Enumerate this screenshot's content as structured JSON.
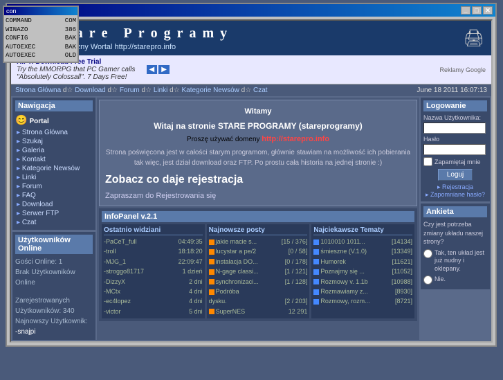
{
  "window": {
    "title": "Stare Programy",
    "controls": [
      "_",
      "□",
      "X"
    ]
  },
  "old_window": {
    "title": "con",
    "rows": [
      {
        "label": "COMMAND",
        "value": "COM"
      },
      {
        "label": "WINAZO",
        "value": "386"
      },
      {
        "label": "CONFIG",
        "value": "BAK"
      },
      {
        "label": "AUTOEXEC",
        "value": "BAK"
      },
      {
        "label": "AUTOEXEC",
        "value": "OLD"
      }
    ]
  },
  "site": {
    "logo_text": "Stare Programy",
    "subtitle": "Niezależny Wortal  http://starepro.info",
    "icon": "🖨️"
  },
  "ad": {
    "title": "RIFT: Download Free Trial",
    "line1": "Try the MMORPG that PC Gamer calls",
    "line2": "\"Absolutely Colossall\". 7 Days Free!",
    "google_label": "Reklamy Google"
  },
  "breadcrumb": {
    "items": [
      "Strona Główna",
      "Download",
      "Forum",
      "Linki",
      "Kategorie Newsów",
      "Czat"
    ],
    "separator": "d☆"
  },
  "datetime": "June 18 2011  16:07:13",
  "sidebar": {
    "title": "Nawigacja",
    "emoji": "😊",
    "portal_label": "Portal",
    "items": [
      "Strona Główna",
      "Szukaj",
      "Galeria",
      "Kontakt",
      "Kategorie Newsów",
      "Linki",
      "Forum",
      "FAQ",
      "Download",
      "Serwer FTP",
      "Czat"
    ]
  },
  "online": {
    "title": "Użytkowników Online",
    "guests": "Gości Online: 1",
    "no_users": "Brak Użytkowników Online",
    "registered_label": "Zarejestrowanych Użytkowników: 340",
    "newest_label": "Najnowszy Użytkownik:",
    "newest": "-snajpi"
  },
  "welcome": {
    "section": "Witamy",
    "title": "Witaj na stronie STARE PROGRAMY (stareprogramy)",
    "domain_prompt": "Proszę używać domeny",
    "domain": "http://starepro.info",
    "text": "Strona poświęcona jest w całości starym programom, głównie stawiam na możliwość ich pobierania tak więc, jest dział download oraz FTP. Po prostu cała historia na jednej stronie :)",
    "big_text": "Zobacz co daje rejestracja",
    "register_text": "Zapraszam do Rejestrowania się"
  },
  "infopanel": {
    "title": "InfoPanel v.2.1",
    "cols": [
      {
        "title": "Ostatnio widziani",
        "rows": [
          {
            "name": "-PaCeT_full",
            "time": "04:49:35"
          },
          {
            "name": "-troll",
            "time": "18:18:20"
          },
          {
            "name": "-MJG_1",
            "time": "22:09:47"
          },
          {
            "name": "-stroggo81717",
            "time": "1 dzień"
          },
          {
            "name": "-DizzyX",
            "time": "2 dni"
          },
          {
            "name": "-MCtx",
            "time": "4 dni"
          },
          {
            "name": "-ec4lopez",
            "time": "4 dni"
          },
          {
            "name": "-victor",
            "time": "5 dni"
          }
        ]
      },
      {
        "title": "Najnowsze posty",
        "rows": [
          {
            "name": "jakie macie s...",
            "count": "[15 / 376]"
          },
          {
            "name": "lucystar a pe/2",
            "count": "[0 / 58]"
          },
          {
            "name": "instalacja DO...",
            "count": "[0 / 178]"
          },
          {
            "name": "N-gage classi...",
            "count": "[1 / 121]"
          },
          {
            "name": "synchronizaci...",
            "count": "[1 / 128]"
          },
          {
            "name": "Podróba",
            "count": ""
          },
          {
            "name": "dysku.",
            "count": "[2 / 203]"
          },
          {
            "name": "SuperNES",
            "count": "12 291"
          }
        ]
      },
      {
        "title": "Najciekawsze Tematy",
        "rows": [
          {
            "name": "1010010 1011...",
            "count": "[14134]"
          },
          {
            "name": "śmieszne (V.1.0)",
            "count": "[13349]"
          },
          {
            "name": "Humorek",
            "count": "[11621]"
          },
          {
            "name": "Poznajmy się ...",
            "count": "[11052]"
          },
          {
            "name": "Rozmowy v. 1.1b",
            "count": "[10988]"
          },
          {
            "name": "Rozmawiamy z...",
            "count": "[8930]"
          },
          {
            "name": "Rozmowy, rozm...",
            "count": "[8721]"
          }
        ]
      }
    ]
  },
  "login": {
    "title": "Logowanie",
    "username_label": "Nazwa Użytkownika:",
    "password_label": "Hasło",
    "remember_label": "Zapamiętaj mnie",
    "button": "Loguj",
    "register_link": "Rejestracja",
    "forgot_link": "Zapomniane hasło?"
  },
  "poll": {
    "title": "Ankieta",
    "question": "Czy jest potrzeba zmiany układu naszej strony?",
    "options": [
      "Tak, ten układ jest już nudny i oklepany.",
      "Nie."
    ]
  }
}
